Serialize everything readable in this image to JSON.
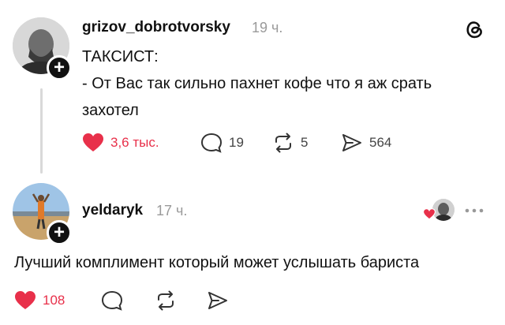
{
  "post": {
    "username": "grizov_dobrotvorsky",
    "time": "19 ч.",
    "text_line1": "ТАКСИСТ:",
    "text_line2": "- От Вас так сильно пахнет кофе что я аж срать",
    "text_line3": "захотел",
    "likes": "3,6 тыс.",
    "comments": "19",
    "reposts": "5",
    "shares": "564"
  },
  "reply": {
    "username": "yeldaryk",
    "time": "17 ч.",
    "text": "Лучший комплимент который может услышать бариста",
    "likes": "108",
    "more_icon": "ellipsis-icon"
  },
  "colors": {
    "like_red": "#e8304a",
    "text": "#111111",
    "muted": "#9a9a9a"
  }
}
